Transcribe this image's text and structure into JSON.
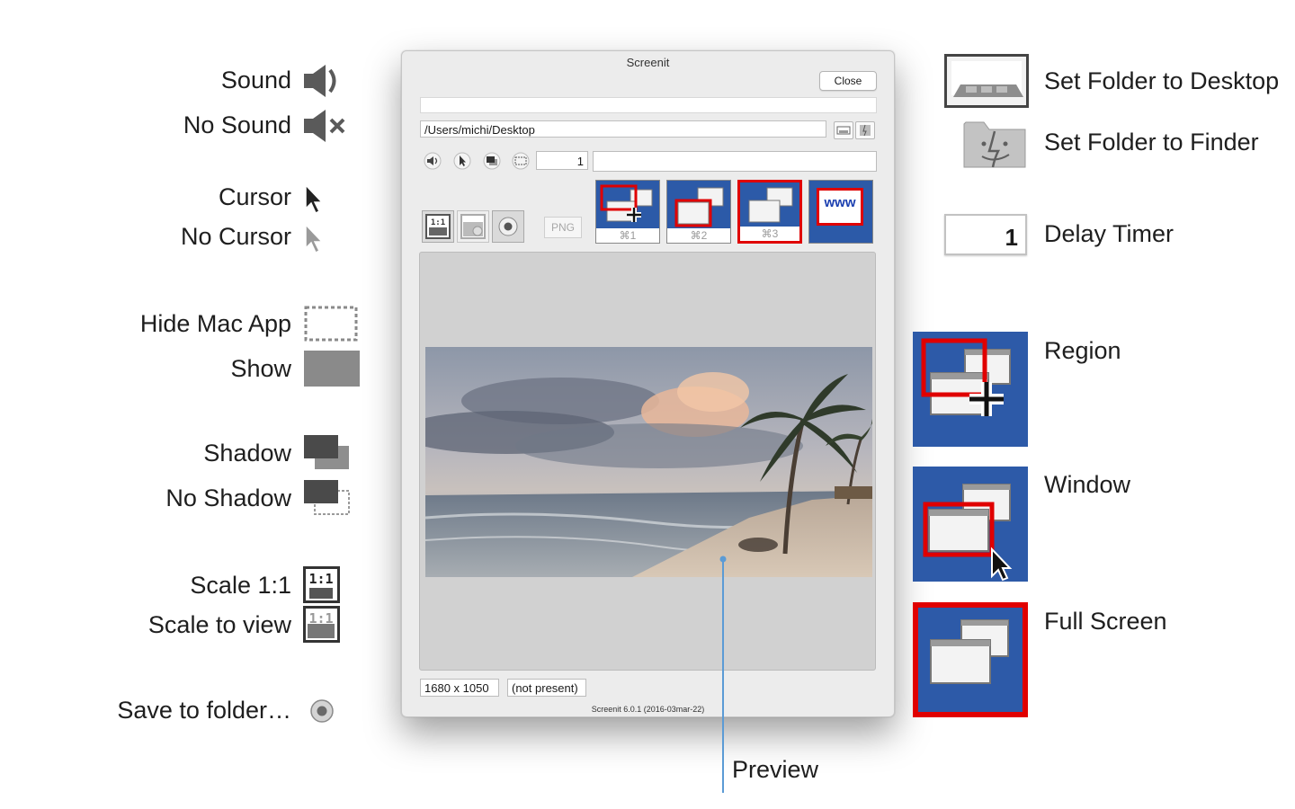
{
  "legend_left": {
    "sound": "Sound",
    "no_sound": "No Sound",
    "cursor": "Cursor",
    "no_cursor": "No Cursor",
    "hide_mac_app": "Hide Mac App",
    "show": "Show",
    "shadow": "Shadow",
    "no_shadow": "No Shadow",
    "scale_1_1": "Scale 1:1",
    "scale_to_view": "Scale to view",
    "save_to_folder": "Save to folder…"
  },
  "legend_right": {
    "set_folder_desktop": "Set Folder to Desktop",
    "set_folder_finder": "Set Folder to Finder",
    "delay_timer": "Delay Timer",
    "delay_value": "1",
    "region": "Region",
    "window": "Window",
    "full_screen": "Full Screen",
    "preview": "Preview"
  },
  "window": {
    "title": "Screenit",
    "close_label": "Close",
    "path": "/Users/michi/Desktop",
    "delay": "1",
    "format": "PNG",
    "scale_icon_text": "1:1",
    "capture_buttons": [
      {
        "shortcut": "⌘1"
      },
      {
        "shortcut": "⌘2"
      },
      {
        "shortcut": "⌘3"
      },
      {
        "text": "www"
      }
    ],
    "resolution": "1680 x 1050",
    "status": "(not present)",
    "version": "Screenit 6.0.1 (2016-03mar-22)"
  },
  "colors": {
    "capture_blue": "#2d5aa8",
    "selection_red": "#e00000",
    "preview_line": "#5b9bd5"
  }
}
